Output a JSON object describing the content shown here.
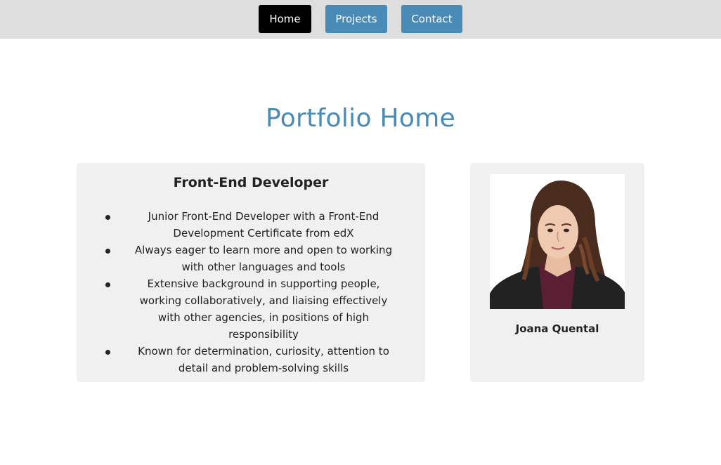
{
  "nav": {
    "home_label": "Home",
    "projects_label": "Projects",
    "contact_label": "Contact",
    "active": "Home",
    "active_color": "#000000",
    "accent_color": "#4a8ab6"
  },
  "main": {
    "title": "Portfolio Home"
  },
  "about": {
    "heading": "Front-End Developer",
    "items": [
      "Junior Front-End Developer with a Front-End Development Certificate from edX",
      "Always eager to learn more and open to working with other languages and tools",
      "Extensive background in supporting people, working collaboratively, and liaising effectively with other agencies, in positions of high responsibility",
      "Known for determination, curiosity, attention to detail and problem-solving skills"
    ]
  },
  "profile": {
    "name": "Joana Quental",
    "photo_icon": "profile-photo"
  }
}
